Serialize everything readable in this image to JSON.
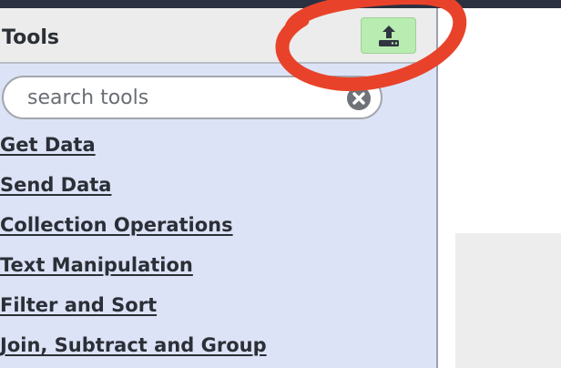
{
  "tool_panel": {
    "title": "Tools",
    "upload_icon": "upload-icon",
    "search": {
      "placeholder": "search tools",
      "value": "",
      "clear_icon": "clear-icon"
    },
    "sections": [
      {
        "label": "Get Data"
      },
      {
        "label": "Send Data"
      },
      {
        "label": "Collection Operations"
      },
      {
        "label": "Text Manipulation"
      },
      {
        "label": "Filter and Sort"
      },
      {
        "label": "Join, Subtract and Group"
      }
    ]
  },
  "colors": {
    "topbar": "#2b3140",
    "panel_background": "#dde3f7",
    "header_background": "#ececec",
    "upload_button": "#b9ecb0",
    "annotation_circle": "#e8432a"
  }
}
